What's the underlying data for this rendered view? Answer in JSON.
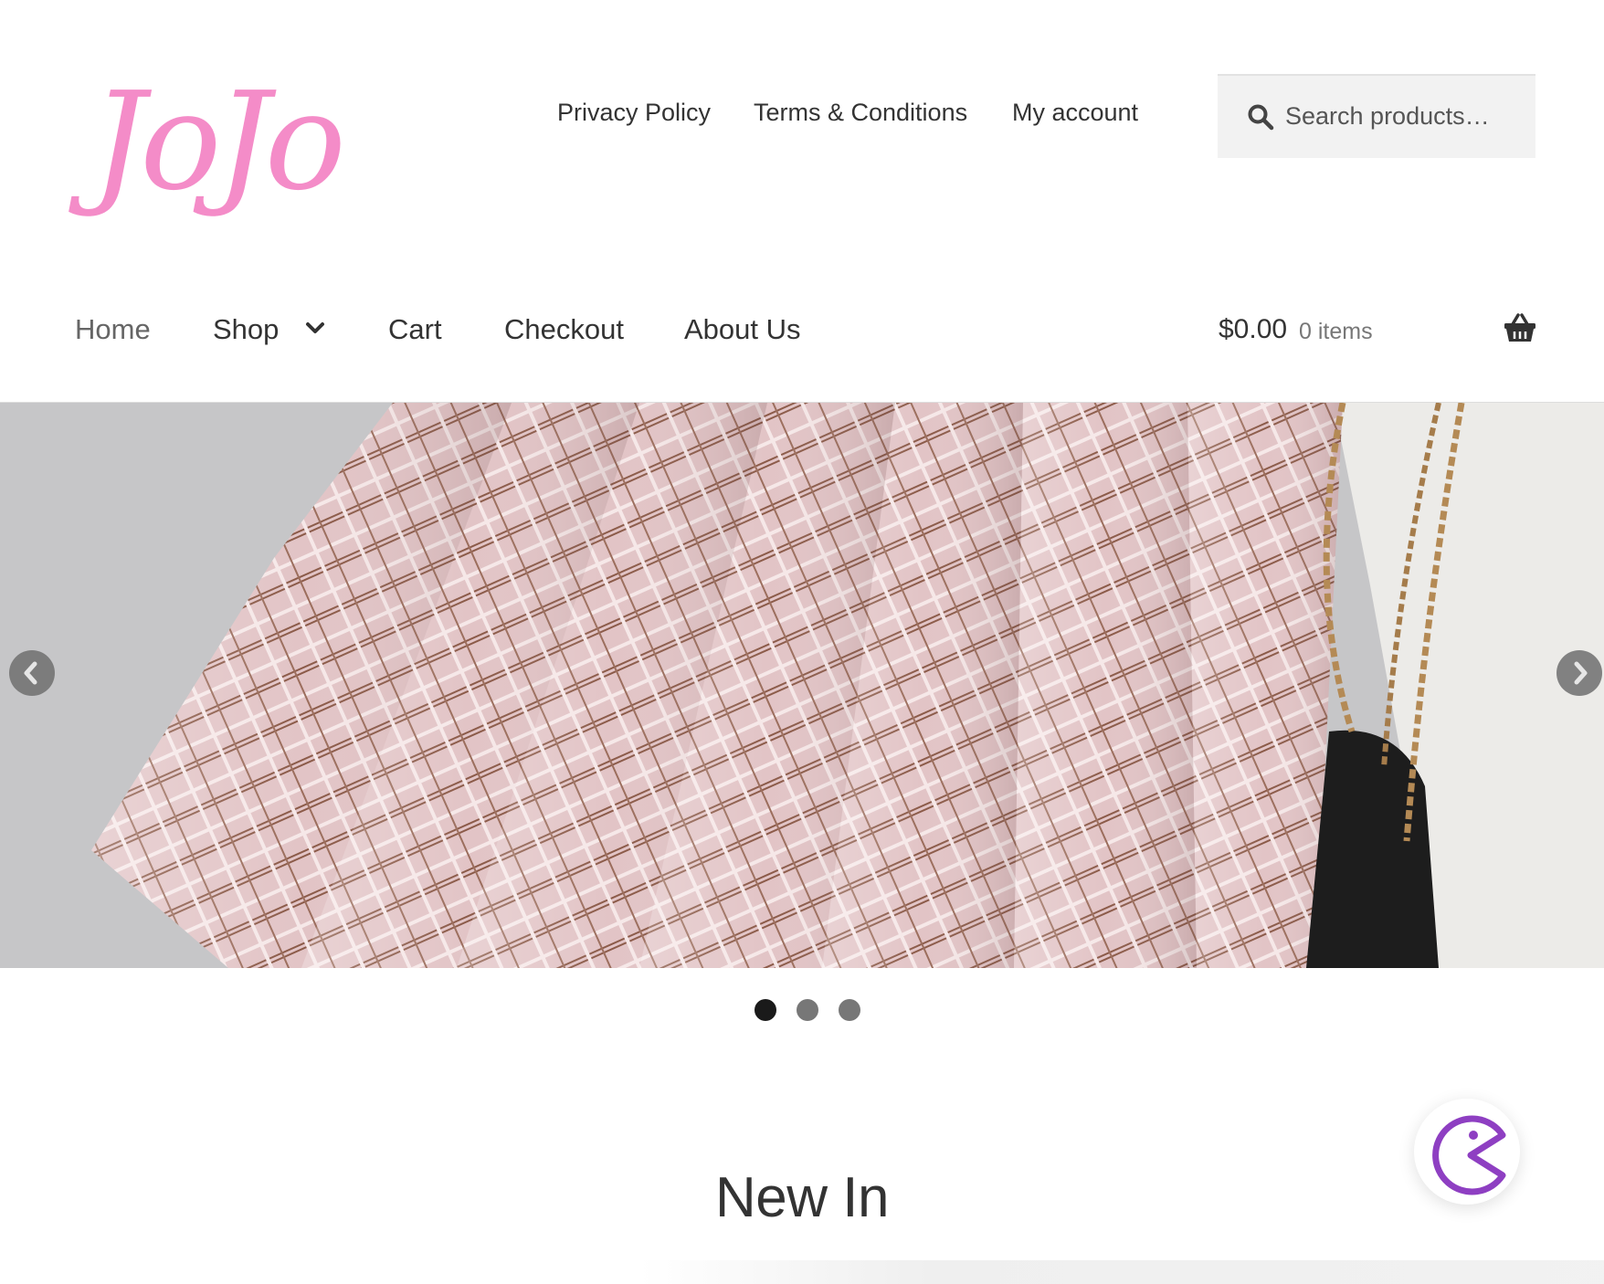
{
  "site": {
    "logo_text": "JoJo"
  },
  "secondary_nav": [
    {
      "label": "Privacy Policy"
    },
    {
      "label": "Terms & Conditions"
    },
    {
      "label": "My account"
    }
  ],
  "search": {
    "placeholder": "Search products…"
  },
  "primary_nav": {
    "home": "Home",
    "shop": "Shop",
    "cart": "Cart",
    "checkout": "Checkout",
    "about": "About Us"
  },
  "cart": {
    "total": "$0.00",
    "items": "0 items"
  },
  "slider": {
    "slide_count": 3,
    "active_slide": 1
  },
  "section": {
    "title": "New In"
  },
  "colors": {
    "logo": "#f48cc8",
    "chat_accent": "#8e3fc2"
  },
  "icons": [
    "search-icon",
    "chevron-down-icon",
    "basket-icon",
    "arrow-left-icon",
    "arrow-right-icon",
    "chat-icon"
  ]
}
